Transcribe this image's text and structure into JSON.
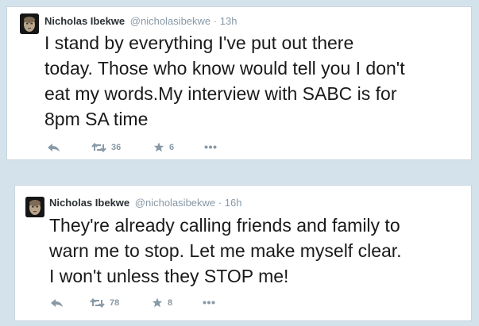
{
  "tweets": [
    {
      "author_name": "Nicholas Ibekwe",
      "handle": "@nicholasibekwe",
      "time": "13h",
      "text_lines": [
        "I stand by everything I've put out there",
        "today. Those who know would tell you I don't",
        "eat my words.My interview with SABC is for",
        "8pm SA time"
      ],
      "retweets": "36",
      "favorites": "6"
    },
    {
      "author_name": "Nicholas Ibekwe",
      "handle": "@nicholasibekwe",
      "time": "16h",
      "text_lines": [
        "They're already calling friends and family to",
        "warn me to stop. Let me make myself clear.",
        "I won't unless they STOP me!"
      ],
      "retweets": "78",
      "favorites": "8"
    }
  ],
  "separator": "·",
  "icons": {
    "reply": "reply-icon",
    "retweet": "retweet-icon",
    "favorite": "star-icon",
    "more": "more-icon"
  },
  "colors": {
    "background": "#d4e2ec",
    "card": "#ffffff",
    "muted": "#8899a6",
    "text": "#1a1a1a"
  }
}
